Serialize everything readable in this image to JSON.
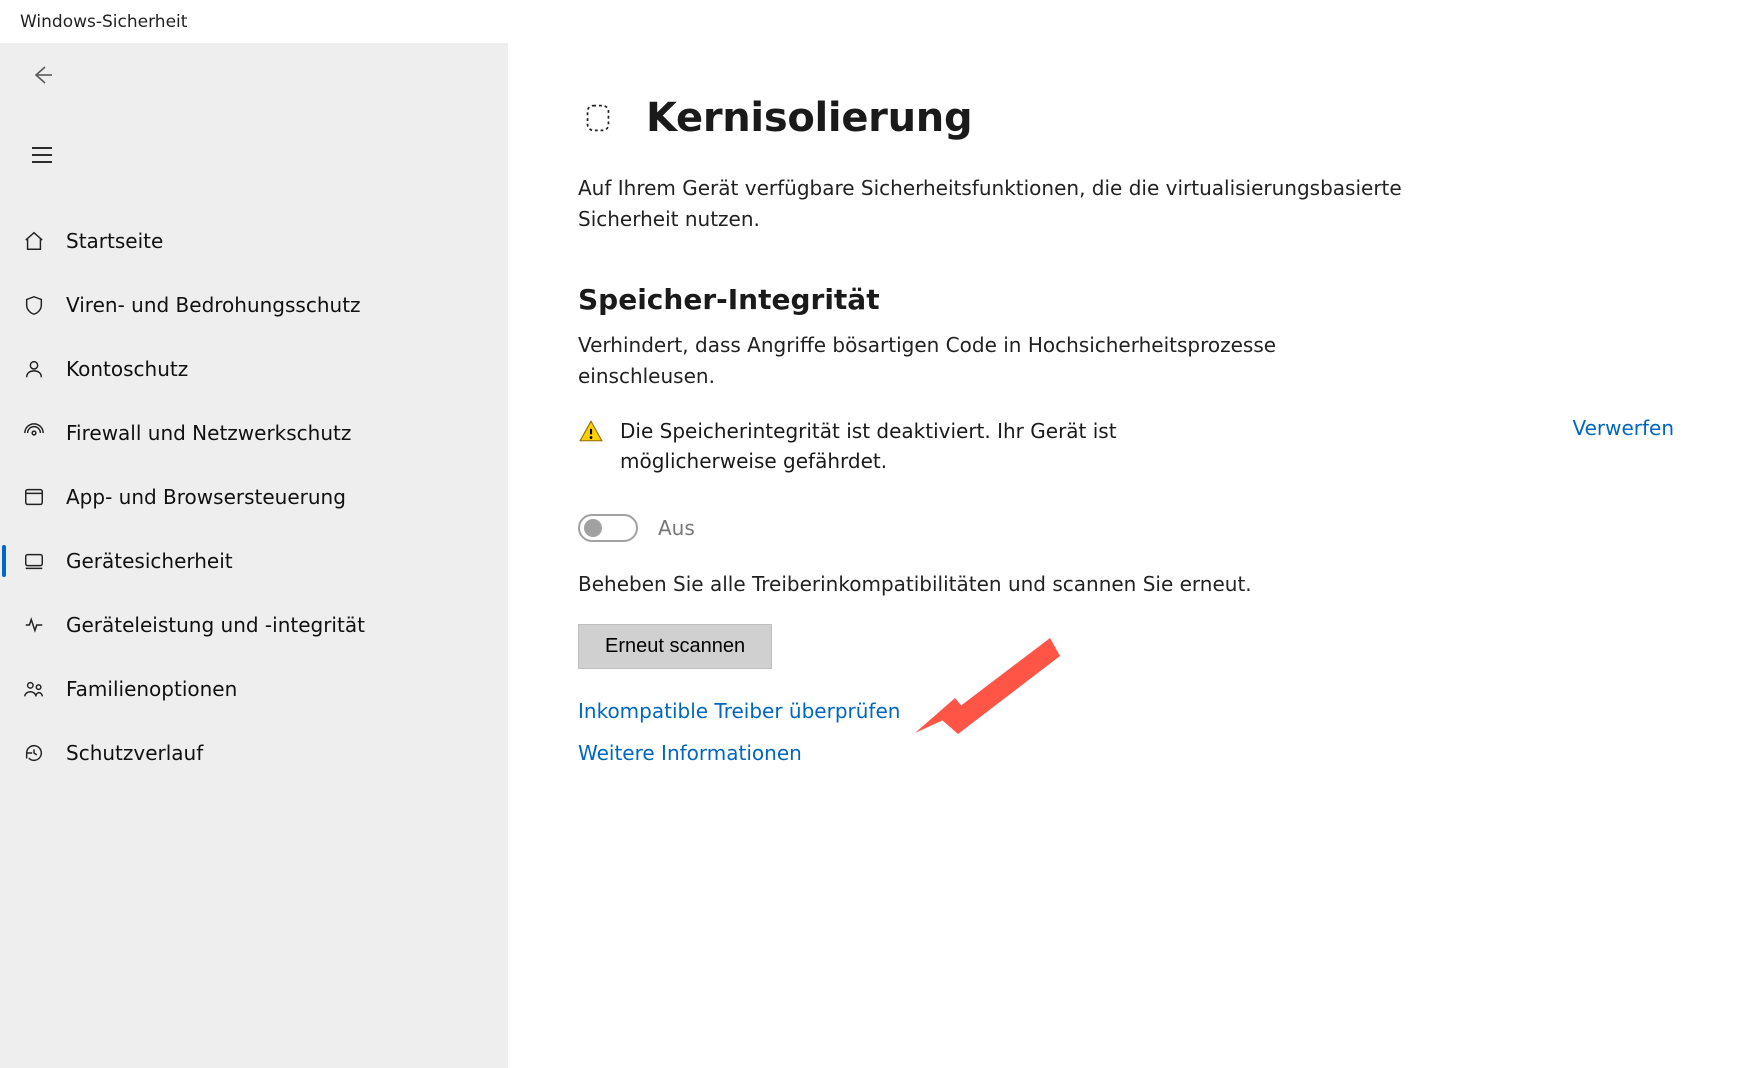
{
  "window": {
    "title": "Windows-Sicherheit"
  },
  "sidebar": {
    "back": "Zurück",
    "hamburger": "Menü",
    "items": [
      {
        "icon": "home-icon",
        "label": "Startseite"
      },
      {
        "icon": "shield-icon",
        "label": "Viren- und Bedrohungsschutz"
      },
      {
        "icon": "account-icon",
        "label": "Kontoschutz"
      },
      {
        "icon": "firewall-icon",
        "label": "Firewall und Netzwerkschutz"
      },
      {
        "icon": "app-ctrl-icon",
        "label": "App- und Browsersteuerung"
      },
      {
        "icon": "device-sec-icon",
        "label": "Gerätesicherheit"
      },
      {
        "icon": "device-hlth-icon",
        "label": "Geräteleistung und -integrität"
      },
      {
        "icon": "family-icon",
        "label": "Familienoptionen"
      },
      {
        "icon": "history-icon",
        "label": "Schutzverlauf"
      }
    ],
    "selected_index": 5
  },
  "main": {
    "title": "Kernisolierung",
    "subtitle": "Auf Ihrem Gerät verfügbare Sicherheitsfunktionen, die die virtualisierungsbasierte Sicherheit nutzen.",
    "section": {
      "title": "Speicher-Integrität",
      "desc": "Verhindert, dass Angriffe bösartigen Code in Hochsicherheitsprozesse einschleusen.",
      "state_text": "Die Speicherintegrität ist deaktiviert. Ihr Gerät ist möglicherweise gefährdet.",
      "dismiss": "Verwerfen",
      "toggle_label": "Aus",
      "hint": "Beheben Sie alle Treiberinkompatibilitäten und scannen Sie erneut.",
      "scan_button": "Erneut scannen",
      "link_drivers": "Inkompatible Treiber überprüfen",
      "link_more": "Weitere Informationen"
    }
  }
}
